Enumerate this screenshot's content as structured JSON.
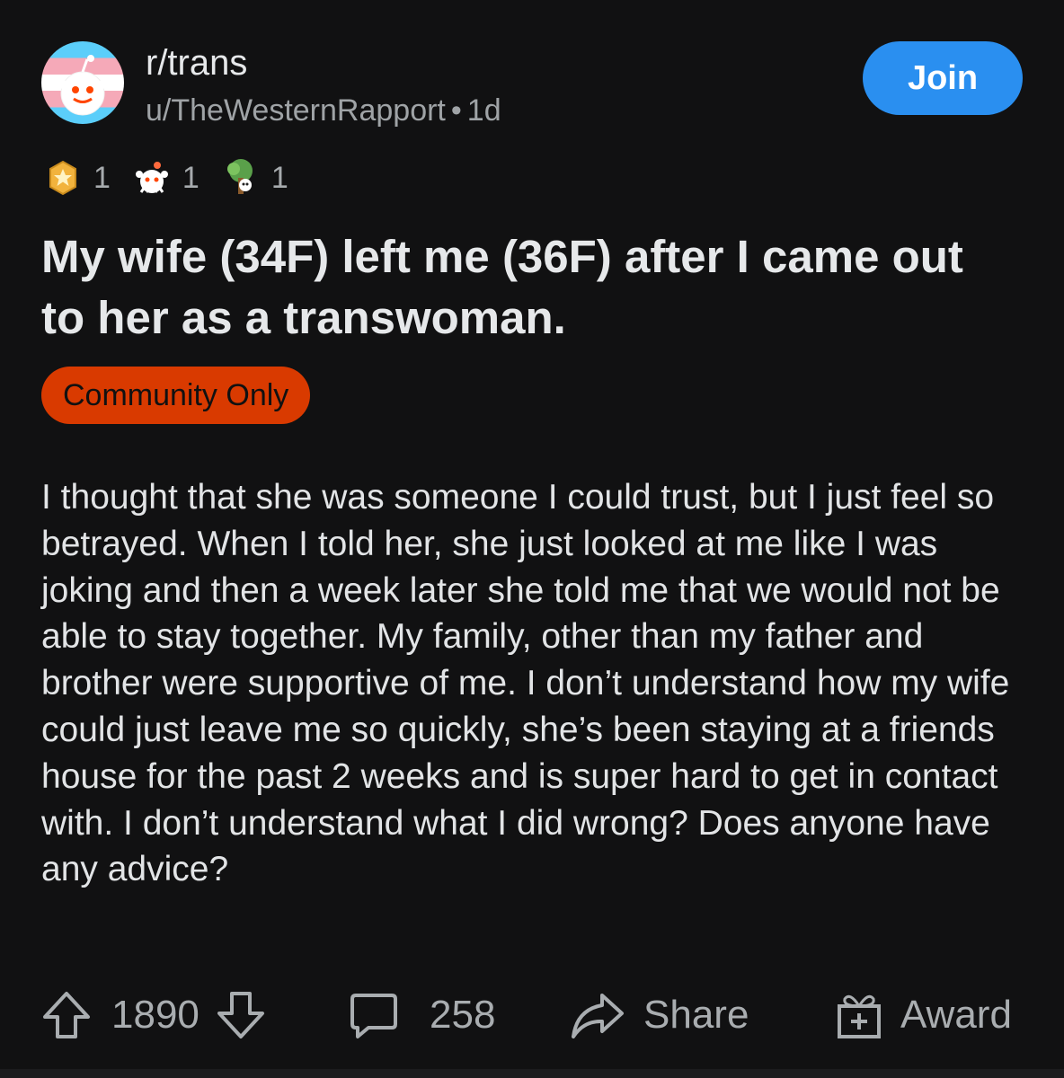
{
  "post": {
    "subreddit": "r/trans",
    "author": "u/TheWesternRapport",
    "age": "1d",
    "join_label": "Join",
    "awards": [
      {
        "icon": "silver-star-award-icon",
        "count": "1"
      },
      {
        "icon": "snoo-wholesome-award-icon",
        "count": "1"
      },
      {
        "icon": "tree-hug-award-icon",
        "count": "1"
      }
    ],
    "title": "My wife (34F) left me (36F) after I came out to her as a transwoman.",
    "flair": "Community Only",
    "body": "I thought that she was someone I could trust, but I just feel so betrayed. When I told her, she just looked at me like I was joking and then a week later she told me that we would not be able to stay together. My family, other than my father and brother were supportive of me. I don’t understand how my wife could just leave me so quickly, she’s been staying at a friends house for the past 2 weeks and is super hard to get in contact with. I don’t understand what I did wrong? Does anyone have any advice?"
  },
  "actions": {
    "upvotes": "1890",
    "comments": "258",
    "share_label": "Share",
    "award_label": "Award"
  },
  "colors": {
    "background": "#111112",
    "join_button": "#2a8ff0",
    "flair": "#d93a00",
    "text": "#e2e4e6",
    "muted": "#9fa3a6"
  }
}
